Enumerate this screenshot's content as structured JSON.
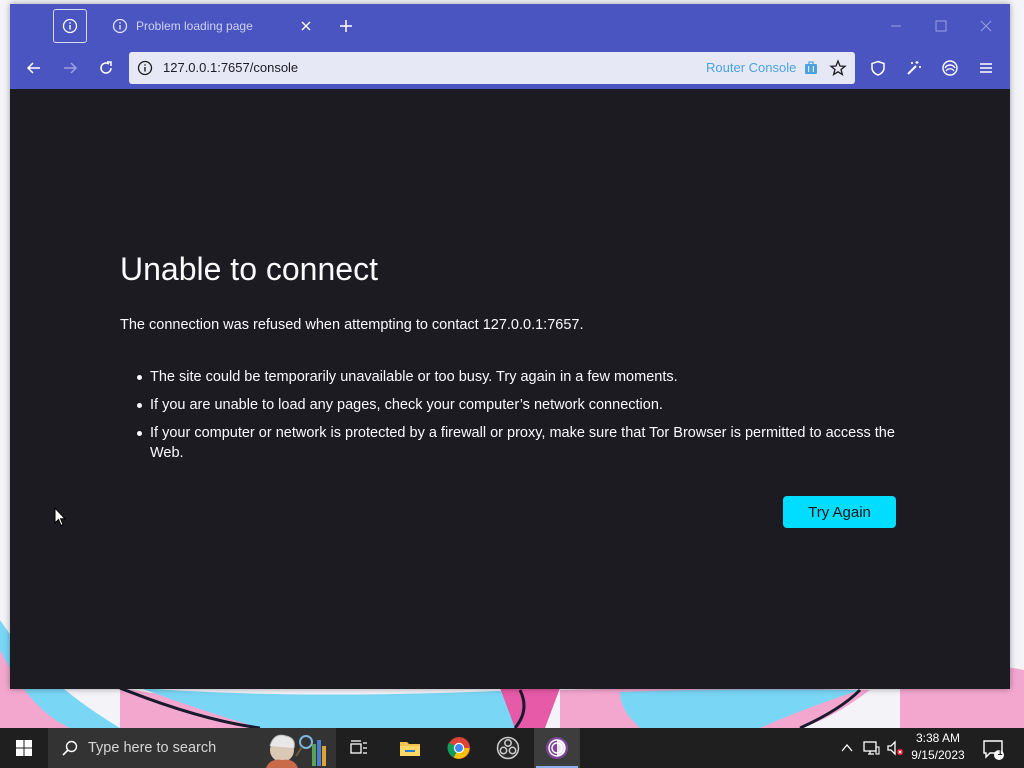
{
  "browser": {
    "tab": {
      "title": "Problem loading page"
    },
    "url": "127.0.0.1:7657/console",
    "url_badge": "Router Console"
  },
  "error": {
    "title": "Unable to connect",
    "description": "The connection was refused when attempting to contact 127.0.0.1:7657.",
    "bullets": [
      "The site could be temporarily unavailable or too busy. Try again in a few moments.",
      "If you are unable to load any pages, check your computer’s network connection.",
      "If your computer or network is protected by a firewall or proxy, make sure that Tor Browser is permitted to access the Web."
    ],
    "button": "Try Again"
  },
  "taskbar": {
    "search_placeholder": "Type here to search",
    "time": "3:38 AM",
    "date": "9/15/2023",
    "notification_count": "1",
    "apps": [
      "task-view",
      "file-explorer",
      "chrome",
      "obs-studio",
      "tor-browser"
    ]
  },
  "colors": {
    "browser_frame": "#4a55c1",
    "page_background": "#1c1b22",
    "primary_button": "#00ddff",
    "taskbar": "#1f1f1f"
  }
}
